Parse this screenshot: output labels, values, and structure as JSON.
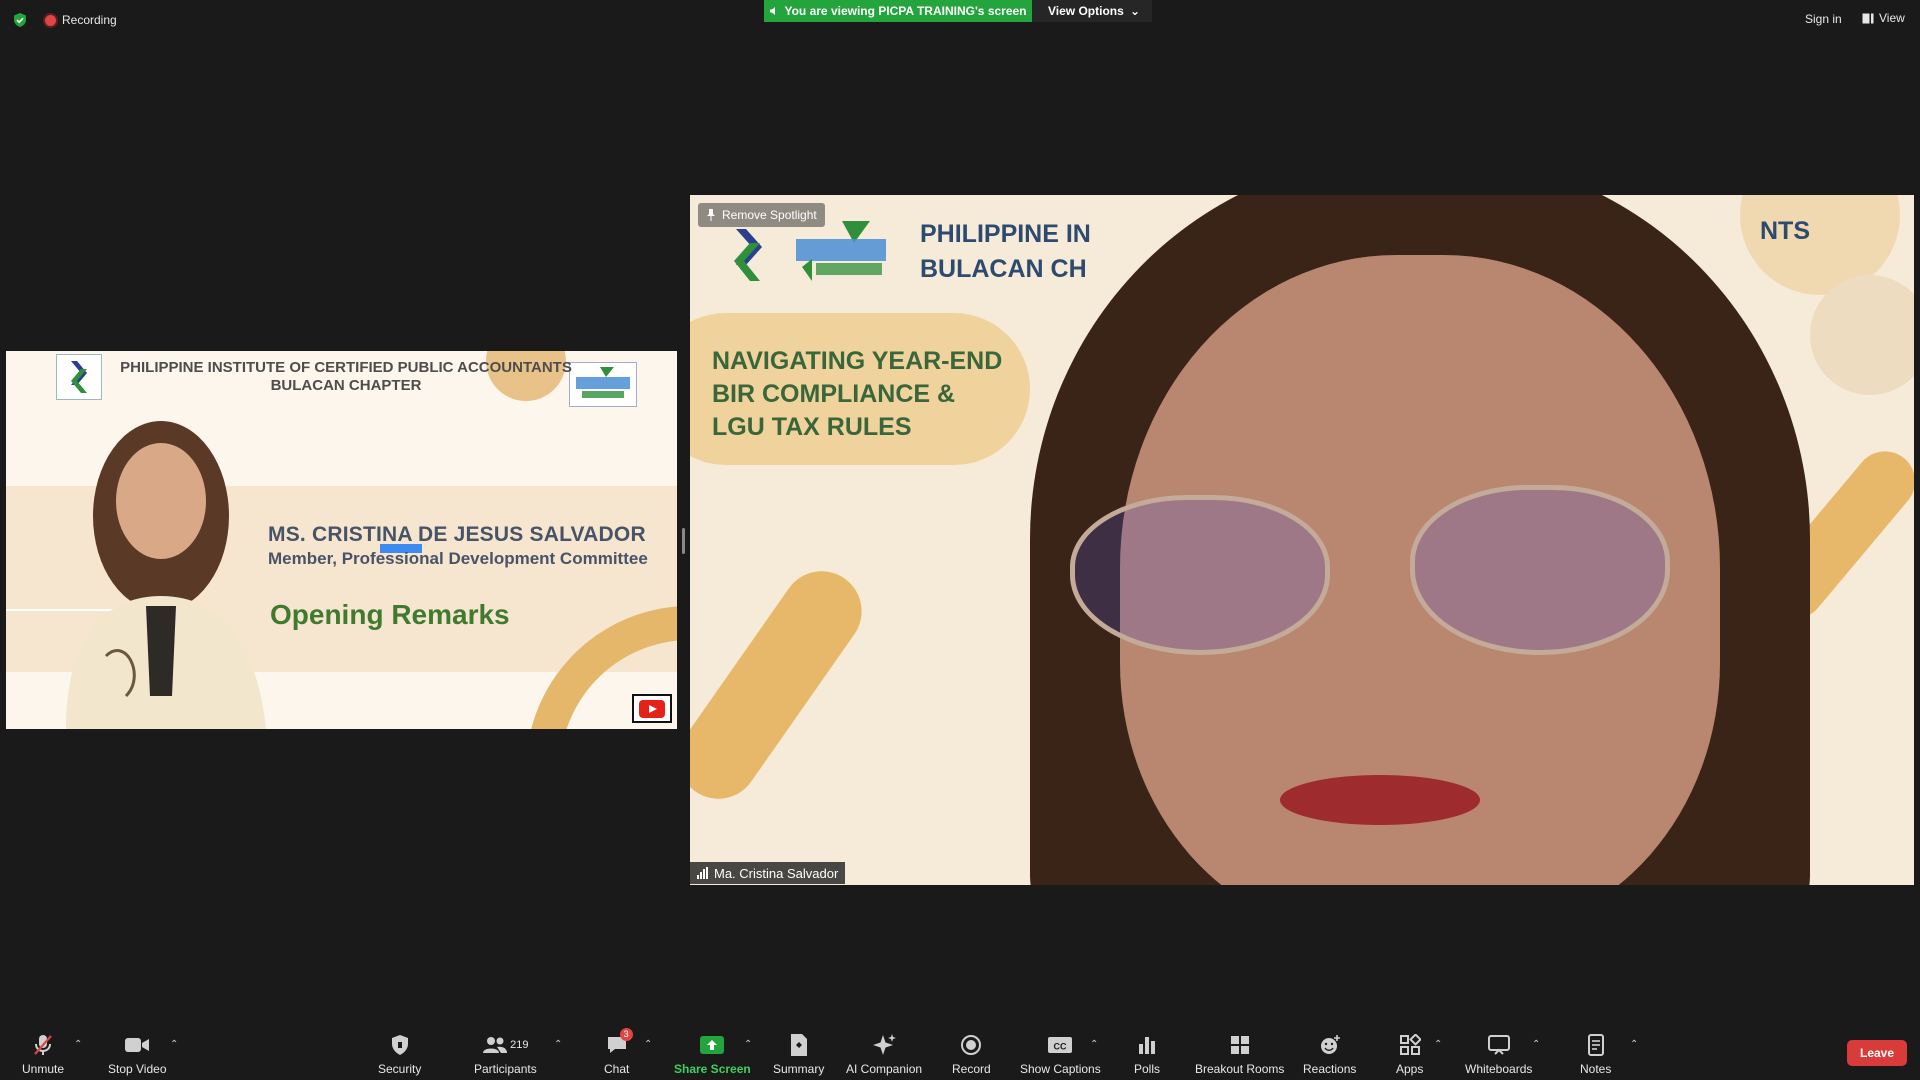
{
  "top_bar": {
    "recording_label": "Recording",
    "viewing_banner": "You are viewing PICPA TRAINING's screen",
    "view_options": "View Options",
    "sign_in": "Sign in",
    "view": "View"
  },
  "shared_slide": {
    "org_line1": "PHILIPPINE INSTITUTE OF CERTIFIED PUBLIC ACCOUNTANTS",
    "org_line2": "BULACAN CHAPTER",
    "speaker_name": "MS. CRISTINA DE JESUS SALVADOR",
    "speaker_role": "Member, Professional Development Committee",
    "segment": "Opening Remarks"
  },
  "spotlight_video": {
    "remove_spotlight": "Remove Spotlight",
    "org_line1": "PHILIPPINE IN",
    "org_line1_right": "NTS",
    "org_line2": "BULACAN CH",
    "title_line1": "NAVIGATING YEAR-END",
    "title_line2": "BIR COMPLIANCE &",
    "title_line3": "LGU TAX RULES",
    "participant_name": "Ma. Cristina Salvador"
  },
  "toolbar": {
    "unmute": "Unmute",
    "stop_video": "Stop Video",
    "security": "Security",
    "participants": "Participants",
    "participant_count": "219",
    "chat": "Chat",
    "chat_badge": "3",
    "share_screen": "Share Screen",
    "summary": "Summary",
    "ai_companion": "AI Companion",
    "record": "Record",
    "show_captions": "Show Captions",
    "polls": "Polls",
    "breakout_rooms": "Breakout Rooms",
    "reactions": "Reactions",
    "apps": "Apps",
    "whiteboards": "Whiteboards",
    "notes": "Notes",
    "leave": "Leave"
  },
  "colors": {
    "share_green": "#23a43c",
    "leave_red": "#d93a3a",
    "recording_red": "#e04545"
  }
}
